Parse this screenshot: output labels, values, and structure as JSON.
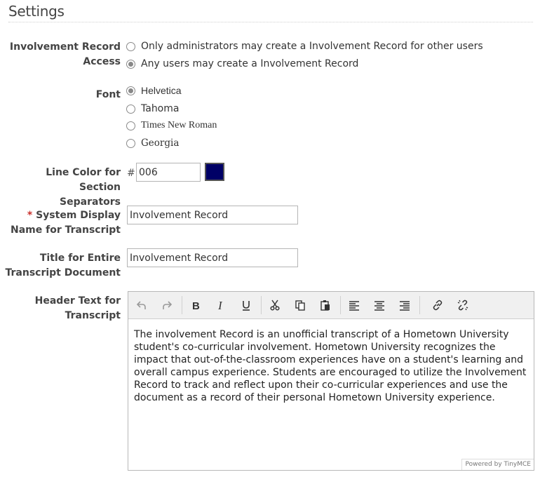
{
  "page": {
    "title": "Settings"
  },
  "involvement_access": {
    "label_line1": "Involvement Record",
    "label_line2": "Access",
    "options": [
      {
        "label": "Only administrators may create a Involvement Record for other users",
        "selected": false
      },
      {
        "label": "Any users may create a Involvement Record",
        "selected": true
      }
    ]
  },
  "font": {
    "label": "Font",
    "options": [
      {
        "label": "Helvetica",
        "selected": true
      },
      {
        "label": "Tahoma",
        "selected": false
      },
      {
        "label": "Times New Roman",
        "selected": false
      },
      {
        "label": "Georgia",
        "selected": false
      }
    ]
  },
  "line_color": {
    "label_line1": "Line Color for Section",
    "label_line2": "Separators",
    "hash": "#",
    "value": "006",
    "swatch_color": "#000066"
  },
  "system_display_name": {
    "required_mark": "*",
    "label_line1": "System Display",
    "label_line2": "Name for Transcript",
    "value": "Involvement Record"
  },
  "document_title": {
    "label_line1": "Title for Entire",
    "label_line2": "Transcript Document",
    "value": "Involvement Record"
  },
  "header_text": {
    "label_line1": "Header Text for",
    "label_line2": "Transcript",
    "content": "The involvement Record is an unofficial transcript of a Hometown University student's co-curricular involvement. Hometown University recognizes the impact that out-of-the-classroom experiences have on a student's learning and overall campus experience. Students are encouraged to utilize the Involvement Record to track and reflect upon their co-curricular experiences and use the document as a record of their personal Hometown University experience.",
    "branding": "Powered by TinyMCE",
    "toolbar_icons": [
      "undo-icon",
      "redo-icon",
      "bold-icon",
      "italic-icon",
      "underline-icon",
      "cut-icon",
      "copy-icon",
      "paste-icon",
      "align-left-icon",
      "align-center-icon",
      "align-right-icon",
      "link-icon",
      "unlink-icon"
    ]
  }
}
